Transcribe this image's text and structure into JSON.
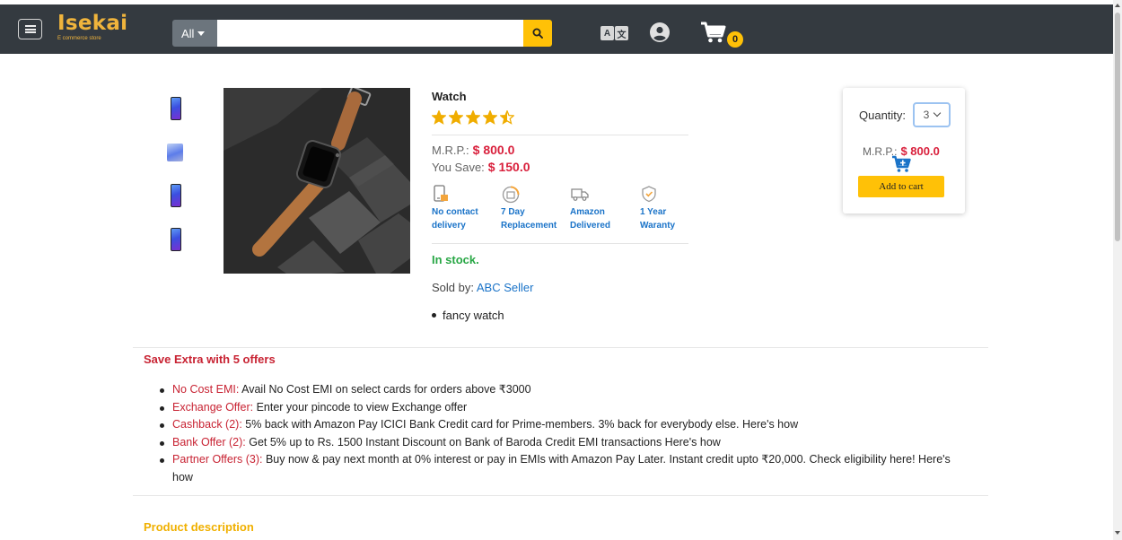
{
  "navbar": {
    "brand_name": "Isekai",
    "brand_tagline": "E commerce store",
    "search_category": "All",
    "search_placeholder": "",
    "cart_count": "0",
    "translate_glyph_a": "A",
    "translate_glyph_b": "文"
  },
  "product": {
    "title": "Watch",
    "rating": 4.5,
    "rating_max": 5,
    "mrp_label": "M.R.P.:",
    "mrp_value": "$ 800.0",
    "save_label": "You Save:",
    "save_value": "$ 150.0",
    "features": [
      {
        "icon": "no-contact-delivery-icon",
        "line1": "No contact",
        "line2": "delivery"
      },
      {
        "icon": "replacement-icon",
        "line1": "7 Day",
        "line2": "Replacement"
      },
      {
        "icon": "delivery-truck-icon",
        "line1": "Amazon",
        "line2": "Delivered"
      },
      {
        "icon": "warranty-shield-icon",
        "line1": "1 Year",
        "line2": "Waranty"
      }
    ],
    "stock": "In stock.",
    "sold_by_label": "Sold by:",
    "seller": "ABC Seller",
    "bullets": [
      "fancy watch"
    ]
  },
  "buybox": {
    "quantity_label": "Quantity:",
    "quantity_value": "3",
    "mrp_label": "M.R.P.:",
    "mrp_value": "$ 800.0",
    "add_to_cart": "Add to cart"
  },
  "offers": {
    "title": "Save Extra with 5 offers",
    "items": [
      {
        "title": "No Cost EMI:",
        "text": " Avail No Cost EMI on select cards for orders above ₹3000"
      },
      {
        "title": "Exchange Offer:",
        "text": " Enter your pincode to view Exchange offer"
      },
      {
        "title": "Cashback (2):",
        "text": " 5% back with Amazon Pay ICICI Bank Credit card for Prime-members. 3% back for everybody else. Here's how"
      },
      {
        "title": "Bank Offer (2):",
        "text": " Get 5% up to Rs. 1500 Instant Discount on Bank of Baroda Credit EMI transactions Here's how"
      },
      {
        "title": "Partner Offers (3):",
        "text": " Buy now & pay next month at 0% interest or pay in EMIs with Amazon Pay Later. Instant credit upto ₹20,000. Check eligibility here! Here's how"
      }
    ]
  },
  "description": {
    "title": "Product description"
  },
  "colors": {
    "navbar": "#343a40",
    "brand": "#f0b43c",
    "accent_yellow": "#ffc107",
    "price_red": "#d9203c",
    "offer_red": "#c82333",
    "link_blue": "#1a73c8",
    "stock_green": "#28a745"
  }
}
